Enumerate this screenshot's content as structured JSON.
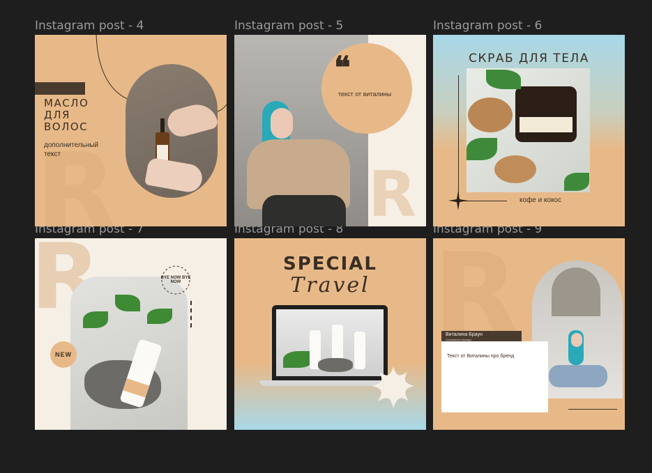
{
  "canvas": {
    "background": "#1e1e1e"
  },
  "frames": [
    {
      "label": "Instagram post - 4"
    },
    {
      "label": "Instagram post - 5"
    },
    {
      "label": "Instagram post - 6"
    },
    {
      "label": "Instagram post - 7"
    },
    {
      "label": "Instagram post - 8"
    },
    {
      "label": "Instagram post - 9"
    }
  ],
  "post4": {
    "title_line1": "МАСЛО",
    "title_line2": "ДЛЯ",
    "title_line3": "ВОЛОС",
    "subtitle_line1": "дополнительный",
    "subtitle_line2": "текст",
    "bg": "#e8b988"
  },
  "post5": {
    "quote_mark": "❝",
    "quote_text": "текст от виталины",
    "circle_color": "#e8b988"
  },
  "post6": {
    "title": "СКРАБ ДЛЯ ТЕЛА",
    "caption": "кофе и кокос"
  },
  "post7": {
    "circle_text": "BYE NOW BYE NOW",
    "badge": "NEW"
  },
  "post8": {
    "title": "SPECIAL",
    "script": "Travel"
  },
  "post9": {
    "name": "Виталина Браун",
    "role": "Основатель бренда",
    "text": "Текст от Виталины про бренд"
  },
  "colors": {
    "peach": "#e8b988",
    "cream": "#f6efe6",
    "dark_brown": "#4a3b2f",
    "sky": "#a8d8e8"
  }
}
